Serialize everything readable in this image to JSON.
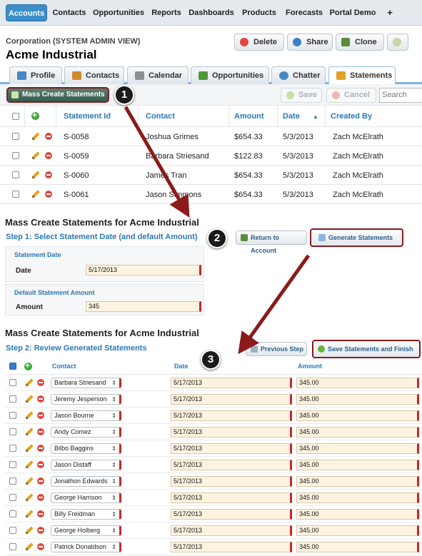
{
  "topnav": {
    "tabs": [
      {
        "label": "Accounts",
        "active": true
      },
      {
        "label": "Contacts"
      },
      {
        "label": "Opportunities"
      },
      {
        "label": "Reports"
      },
      {
        "label": "Dashboards"
      },
      {
        "label": "Products"
      },
      {
        "label": "Forecasts"
      },
      {
        "label": "Portal Demo"
      },
      {
        "label": "+"
      }
    ]
  },
  "header": {
    "breadcrumb": "Corporation (SYSTEM ADMIN VIEW)",
    "title": "Acme Industrial",
    "buttons": [
      {
        "label": "Delete",
        "icon": "delete-icon",
        "color": "#e0473f"
      },
      {
        "label": "Share",
        "icon": "globe-icon",
        "color": "#3b7fc4"
      },
      {
        "label": "Clone",
        "icon": "clone-icon",
        "color": "#5a8d3a"
      }
    ]
  },
  "subtabs": [
    {
      "label": "Profile",
      "icon": "profile-icon",
      "color": "#4a87c6"
    },
    {
      "label": "Contacts",
      "icon": "contacts-icon",
      "color": "#d18a2c"
    },
    {
      "label": "Calendar",
      "icon": "calendar-icon",
      "color": "#8a8f94"
    },
    {
      "label": "Opportunities",
      "icon": "opportunities-icon",
      "color": "#4f9a3a"
    },
    {
      "label": "Chatter",
      "icon": "chatter-icon",
      "color": "#4a87c6"
    },
    {
      "label": "Statements",
      "icon": "statements-icon",
      "color": "#e2a028",
      "active": true
    }
  ],
  "toolbar": {
    "mass_create_label": "Mass Create Statements",
    "save_label": "Save",
    "cancel_label": "Cancel",
    "search_placeholder": "Search"
  },
  "statements_table": {
    "headers": [
      "Statement Id",
      "Contact",
      "Amount",
      "Date",
      "Created By"
    ],
    "sort_indicator": "▲",
    "rows": [
      {
        "id": "S-0058",
        "contact": "Joshua Grimes",
        "amount": "$654.33",
        "date": "5/3/2013",
        "created_by": "Zach McElrath"
      },
      {
        "id": "S-0059",
        "contact": "Barbara Striesand",
        "amount": "$122.83",
        "date": "5/3/2013",
        "created_by": "Zach McElrath"
      },
      {
        "id": "S-0060",
        "contact": "James Tran",
        "amount": "$654.33",
        "date": "5/3/2013",
        "created_by": "Zach McElrath"
      },
      {
        "id": "S-0061",
        "contact": "Jason Simmons",
        "amount": "$654.33",
        "date": "5/3/2013",
        "created_by": "Zach McElrath"
      }
    ]
  },
  "step1": {
    "section_title": "Mass Create Statements for Acme Industrial",
    "step_label": "Step 1: Select Statement Date (and default Amount)",
    "return_label": "Return to Account",
    "generate_label": "Generate Statements",
    "date_section": "Statement Date",
    "date_label": "Date",
    "date_value": "5/17/2013",
    "amount_section": "Default Statement Amount",
    "amount_label": "Amount",
    "amount_value": "345"
  },
  "step2": {
    "section_title": "Mass Create Statements for Acme Industrial",
    "step_label": "Step 2: Review Generated Statements",
    "previous_label": "Previous Step",
    "save_finish_label": "Save Statements and Finish",
    "headers": {
      "contact": "Contact",
      "date": "Date",
      "amount": "Amount"
    },
    "rows": [
      {
        "contact": "Barbara Striesand",
        "date": "5/17/2013",
        "amount": "345.00"
      },
      {
        "contact": "Jeremy Jesperson",
        "date": "5/17/2013",
        "amount": "345.00"
      },
      {
        "contact": "Jason Bourne",
        "date": "5/17/2013",
        "amount": "345.00"
      },
      {
        "contact": "Andy Comez",
        "date": "5/17/2013",
        "amount": "345.00"
      },
      {
        "contact": "Bilbo Baggins",
        "date": "5/17/2013",
        "amount": "345.00"
      },
      {
        "contact": "Jason Distaff",
        "date": "5/17/2013",
        "amount": "345.00"
      },
      {
        "contact": "Jonathon Edwards",
        "date": "5/17/2013",
        "amount": "345.00"
      },
      {
        "contact": "George Harrison",
        "date": "5/17/2013",
        "amount": "345.00"
      },
      {
        "contact": "Billy Freidman",
        "date": "5/17/2013",
        "amount": "345.00"
      },
      {
        "contact": "George Holberg",
        "date": "5/17/2013",
        "amount": "345.00"
      },
      {
        "contact": "Patrick Donaldson",
        "date": "5/17/2013",
        "amount": "345.00"
      }
    ]
  },
  "callouts": [
    "1",
    "2",
    "3"
  ],
  "colors": {
    "accent": "#3b8ec9",
    "highlight": "#8b1a1a",
    "required": "#c62828",
    "link": "#2a78b5"
  }
}
